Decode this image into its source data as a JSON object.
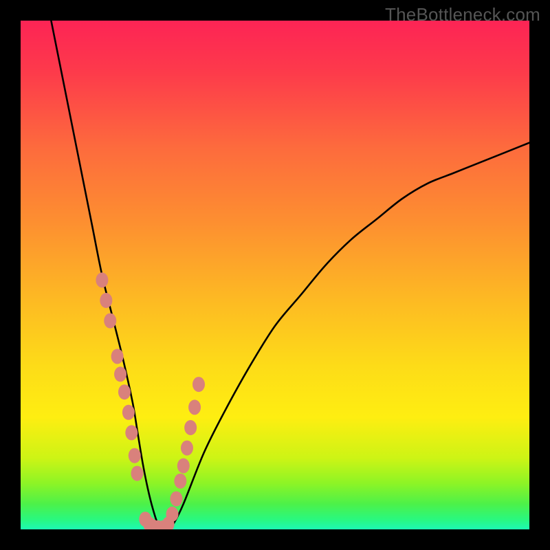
{
  "watermark": "TheBottleneck.com",
  "chart_data": {
    "type": "line",
    "title": "",
    "xlabel": "",
    "ylabel": "",
    "xlim": [
      0,
      100
    ],
    "ylim": [
      0,
      100
    ],
    "series": [
      {
        "name": "bottleneck-curve",
        "x": [
          6,
          8,
          10,
          12,
          14,
          16,
          18,
          20,
          22,
          23,
          24,
          25,
          26,
          27,
          28,
          29,
          30,
          32,
          36,
          40,
          45,
          50,
          55,
          60,
          65,
          70,
          75,
          80,
          85,
          90,
          95,
          100
        ],
        "y": [
          100,
          90,
          80,
          70,
          60,
          50,
          42,
          34,
          25,
          19,
          13,
          8,
          4,
          1,
          0,
          0,
          1,
          5,
          15,
          23,
          32,
          40,
          46,
          52,
          57,
          61,
          65,
          68,
          70,
          72,
          74,
          76
        ]
      }
    ],
    "markers": {
      "name": "highlight-points",
      "color": "#d9817c",
      "x": [
        16.0,
        16.8,
        17.6,
        19.0,
        19.6,
        20.4,
        21.2,
        21.8,
        22.4,
        22.9,
        24.5,
        25.3,
        26.0,
        27.0,
        28.0,
        29.0,
        29.8,
        30.6,
        31.4,
        32.0,
        32.7,
        33.4,
        34.2,
        35.0
      ],
      "y": [
        49.0,
        45.0,
        41.0,
        34.0,
        30.5,
        27.0,
        23.0,
        19.0,
        14.5,
        11.0,
        2.0,
        1.0,
        0.5,
        0.3,
        0.3,
        1.0,
        3.0,
        6.0,
        9.5,
        12.5,
        16.0,
        20.0,
        24.0,
        28.5
      ]
    },
    "background_gradient_stops": [
      {
        "pos": 0,
        "color": "#fd2455"
      },
      {
        "pos": 10,
        "color": "#fd3a4b"
      },
      {
        "pos": 25,
        "color": "#fd6b3d"
      },
      {
        "pos": 40,
        "color": "#fd9030"
      },
      {
        "pos": 55,
        "color": "#fdba23"
      },
      {
        "pos": 68,
        "color": "#fddc18"
      },
      {
        "pos": 78,
        "color": "#feee11"
      },
      {
        "pos": 86,
        "color": "#cdf415"
      },
      {
        "pos": 91,
        "color": "#8cf426"
      },
      {
        "pos": 95,
        "color": "#4df149"
      },
      {
        "pos": 98,
        "color": "#2af87e"
      },
      {
        "pos": 100,
        "color": "#1df8b3"
      }
    ]
  }
}
